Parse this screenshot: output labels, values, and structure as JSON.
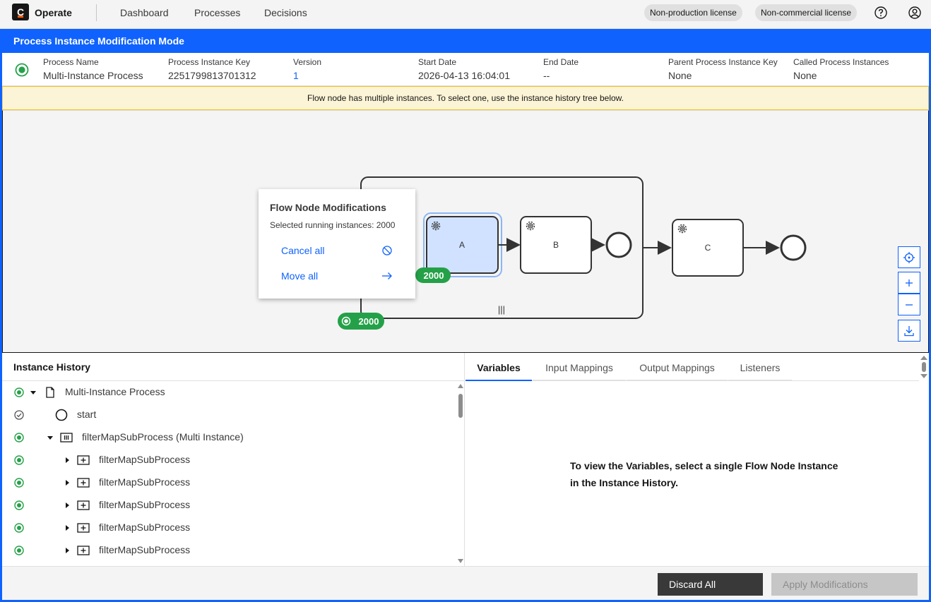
{
  "app": {
    "logo_letter": "C",
    "name": "Operate"
  },
  "nav": {
    "items": [
      "Dashboard",
      "Processes",
      "Decisions"
    ]
  },
  "licenses": [
    "Non-production license",
    "Non-commercial license"
  ],
  "mode_bar": {
    "title": "Process Instance Modification Mode"
  },
  "header": {
    "columns": [
      {
        "label": "Process Name",
        "value": "Multi-Instance Process"
      },
      {
        "label": "Process Instance Key",
        "value": "2251799813701312"
      },
      {
        "label": "Version",
        "value": "1"
      },
      {
        "label": "Start Date",
        "value": "2026-04-13 16:04:01"
      },
      {
        "label": "End Date",
        "value": "--"
      },
      {
        "label": "Parent Process Instance Key",
        "value": "None"
      },
      {
        "label": "Called Process Instances",
        "value": "None"
      }
    ]
  },
  "warning": {
    "text": "Flow node has multiple instances. To select one, use the instance history tree below."
  },
  "diagram": {
    "tasks": [
      "A",
      "B",
      "C"
    ],
    "badge_task": "2000",
    "badge_subprocess": "2000",
    "multi_instance_marker": "|||"
  },
  "popover": {
    "title": "Flow Node Modifications",
    "subtitle": "Selected running instances: 2000",
    "actions": [
      "Cancel all",
      "Move all"
    ]
  },
  "instance_history": {
    "title": "Instance History",
    "rows": [
      {
        "label": "Multi-Instance Process",
        "status": "active",
        "icon": "document-icon"
      },
      {
        "label": "start",
        "status": "completed",
        "icon": "start-event-icon"
      },
      {
        "label": "filterMapSubProcess (Multi Instance)",
        "status": "active",
        "icon": "multi-instance-icon"
      },
      {
        "label": "filterMapSubProcess",
        "status": "active",
        "icon": "subprocess-icon"
      },
      {
        "label": "filterMapSubProcess",
        "status": "active",
        "icon": "subprocess-icon"
      },
      {
        "label": "filterMapSubProcess",
        "status": "active",
        "icon": "subprocess-icon"
      },
      {
        "label": "filterMapSubProcess",
        "status": "active",
        "icon": "subprocess-icon"
      },
      {
        "label": "filterMapSubProcess",
        "status": "active",
        "icon": "subprocess-icon"
      }
    ]
  },
  "variables_panel": {
    "tabs": [
      "Variables",
      "Input Mappings",
      "Output Mappings",
      "Listeners"
    ],
    "active_tab": "Variables",
    "empty_message": "To view the Variables, select a single Flow Node Instance in the Instance History."
  },
  "footer": {
    "discard_label": "Discard All",
    "apply_label": "Apply Modifications"
  },
  "colors": {
    "brand_blue": "#0f62fe",
    "active_green": "#24a148",
    "warning_bg": "#fcf4d6"
  }
}
